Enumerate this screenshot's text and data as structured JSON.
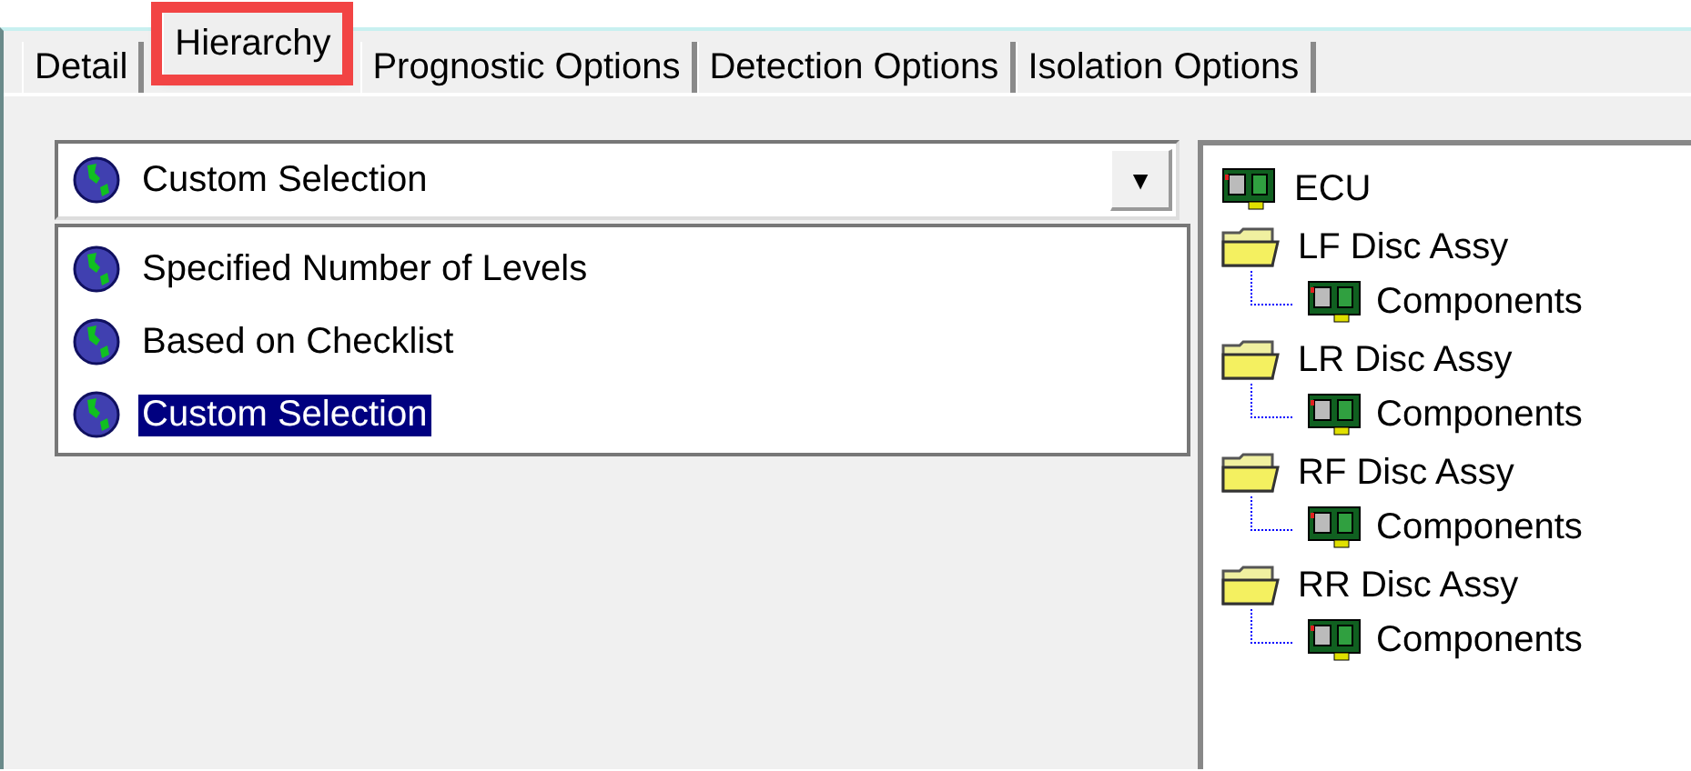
{
  "tabs": [
    {
      "label": "Detail",
      "selected": false
    },
    {
      "label": "Hierarchy",
      "selected": true
    },
    {
      "label": "Prognostic Options",
      "selected": false
    },
    {
      "label": "Detection Options",
      "selected": false
    },
    {
      "label": "Isolation Options",
      "selected": false
    }
  ],
  "dropdown": {
    "value": "Custom Selection",
    "arrow": "▼"
  },
  "options": [
    {
      "label": "Specified Number of Levels",
      "selected": false
    },
    {
      "label": "Based on Checklist",
      "selected": false
    },
    {
      "label": "Custom Selection",
      "selected": true
    }
  ],
  "tree": [
    {
      "label": "ECU",
      "kind": "board"
    },
    {
      "label": "LF Disc Assy",
      "kind": "folder",
      "children": [
        {
          "label": "Components",
          "kind": "board"
        }
      ]
    },
    {
      "label": "LR Disc Assy",
      "kind": "folder",
      "children": [
        {
          "label": "Components",
          "kind": "board"
        }
      ]
    },
    {
      "label": "RF Disc Assy",
      "kind": "folder",
      "children": [
        {
          "label": "Components",
          "kind": "board"
        }
      ]
    },
    {
      "label": "RR Disc Assy",
      "kind": "folder",
      "children": [
        {
          "label": "Components",
          "kind": "board"
        }
      ]
    }
  ]
}
